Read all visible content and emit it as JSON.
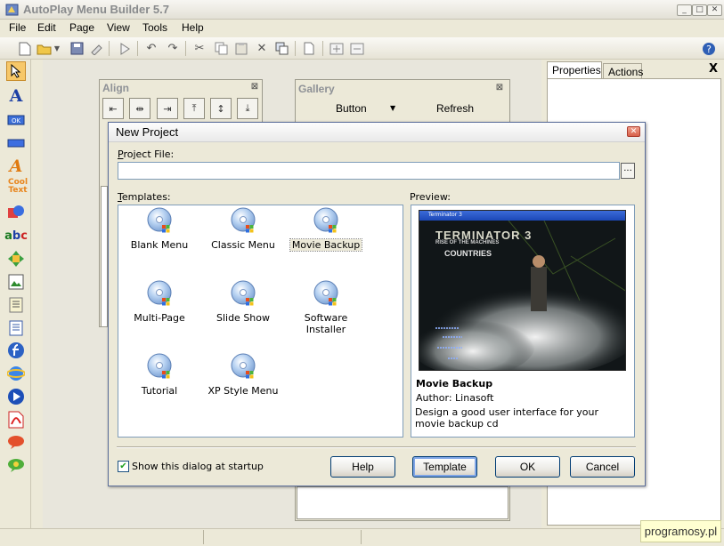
{
  "app": {
    "title": "AutoPlay Menu Builder 5.7"
  },
  "menubar": [
    "File",
    "Edit",
    "Page",
    "View",
    "Tools",
    "Help"
  ],
  "side_panel": {
    "tabs": [
      "Properties",
      "Actions"
    ],
    "close": "X"
  },
  "align_window": {
    "title": "Align",
    "close": "⊠"
  },
  "gallery_window": {
    "title": "Gallery",
    "close": "⊠",
    "button_label": "Button",
    "refresh_label": "Refresh"
  },
  "dialog": {
    "title": "New Project",
    "project_file_label": "Project File:",
    "project_file_value": "",
    "browse_label": "...",
    "templates_label": "Templates:",
    "preview_label": "Preview:",
    "templates": [
      "Blank Menu",
      "Classic Menu",
      "Movie Backup",
      "Multi-Page",
      "Slide Show",
      "Software Installer",
      "Tutorial",
      "XP Style Menu"
    ],
    "selected_template": "Movie Backup",
    "preview": {
      "name": "Movie Backup",
      "author": "Author:  Linasoft",
      "description": "Design a good user interface for your movie backup cd",
      "shot_title_line1": "TERMINATOR 3",
      "shot_title_line2": "RISE OF THE MACHINES",
      "shot_title_line3": "COUNTRIES",
      "shot_window_title": "Terminator 3"
    },
    "show_at_startup_label": "Show this dialog at startup",
    "show_at_startup_checked": true,
    "buttons": {
      "help": "Help",
      "template": "Template",
      "ok": "OK",
      "cancel": "Cancel"
    }
  },
  "watermark": "programosy.pl"
}
